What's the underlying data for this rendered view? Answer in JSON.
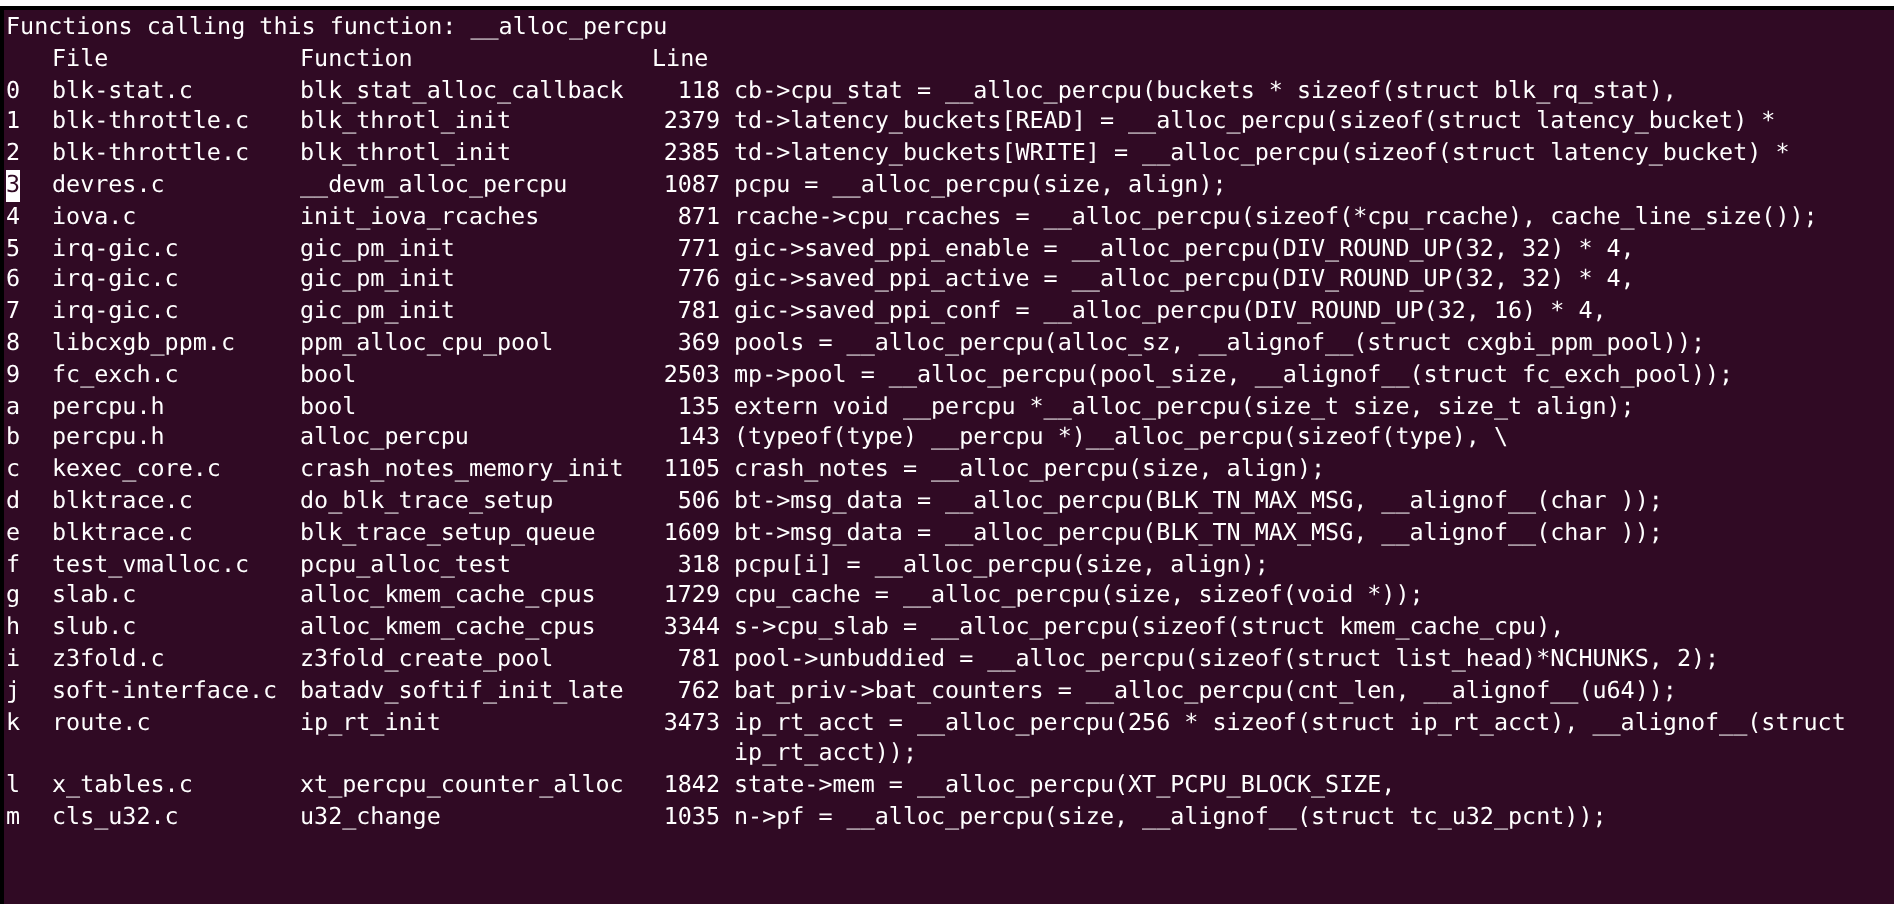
{
  "title": "Functions calling this function: __alloc_percpu",
  "columns": [
    "File",
    "Function",
    "Line"
  ],
  "rows": [
    {
      "index": "0",
      "file": "blk-stat.c",
      "function": "blk_stat_alloc_callback",
      "line": "118",
      "code": "cb->cpu_stat = __alloc_percpu(buckets * sizeof(struct blk_rq_stat),",
      "selected": false
    },
    {
      "index": "1",
      "file": "blk-throttle.c",
      "function": "blk_throtl_init",
      "line": "2379",
      "code": "td->latency_buckets[READ] = __alloc_percpu(sizeof(struct latency_bucket) *",
      "selected": false
    },
    {
      "index": "2",
      "file": "blk-throttle.c",
      "function": "blk_throtl_init",
      "line": "2385",
      "code": "td->latency_buckets[WRITE] = __alloc_percpu(sizeof(struct latency_bucket) *",
      "selected": false
    },
    {
      "index": "3",
      "file": "devres.c",
      "function": "__devm_alloc_percpu",
      "line": "1087",
      "code": "pcpu = __alloc_percpu(size, align);",
      "selected": true
    },
    {
      "index": "4",
      "file": "iova.c",
      "function": "init_iova_rcaches",
      "line": "871",
      "code": "rcache->cpu_rcaches = __alloc_percpu(sizeof(*cpu_rcache), cache_line_size());",
      "selected": false
    },
    {
      "index": "5",
      "file": "irq-gic.c",
      "function": "gic_pm_init",
      "line": "771",
      "code": "gic->saved_ppi_enable = __alloc_percpu(DIV_ROUND_UP(32, 32) * 4,",
      "selected": false
    },
    {
      "index": "6",
      "file": "irq-gic.c",
      "function": "gic_pm_init",
      "line": "776",
      "code": "gic->saved_ppi_active = __alloc_percpu(DIV_ROUND_UP(32, 32) * 4,",
      "selected": false
    },
    {
      "index": "7",
      "file": "irq-gic.c",
      "function": "gic_pm_init",
      "line": "781",
      "code": "gic->saved_ppi_conf = __alloc_percpu(DIV_ROUND_UP(32, 16) * 4,",
      "selected": false
    },
    {
      "index": "8",
      "file": "libcxgb_ppm.c",
      "function": "ppm_alloc_cpu_pool",
      "line": "369",
      "code": "pools = __alloc_percpu(alloc_sz, __alignof__(struct cxgbi_ppm_pool));",
      "selected": false
    },
    {
      "index": "9",
      "file": "fc_exch.c",
      "function": "bool",
      "line": "2503",
      "code": "mp->pool = __alloc_percpu(pool_size, __alignof__(struct fc_exch_pool));",
      "selected": false
    },
    {
      "index": "a",
      "file": "percpu.h",
      "function": "bool",
      "line": "135",
      "code": "extern void __percpu *__alloc_percpu(size_t size, size_t align);",
      "selected": false
    },
    {
      "index": "b",
      "file": "percpu.h",
      "function": "alloc_percpu",
      "line": "143",
      "code": "(typeof(type) __percpu *)__alloc_percpu(sizeof(type), \\",
      "selected": false
    },
    {
      "index": "c",
      "file": "kexec_core.c",
      "function": "crash_notes_memory_init",
      "line": "1105",
      "code": "crash_notes = __alloc_percpu(size, align);",
      "selected": false
    },
    {
      "index": "d",
      "file": "blktrace.c",
      "function": "do_blk_trace_setup",
      "line": "506",
      "code": "bt->msg_data = __alloc_percpu(BLK_TN_MAX_MSG, __alignof__(char ));",
      "selected": false
    },
    {
      "index": "e",
      "file": "blktrace.c",
      "function": "blk_trace_setup_queue",
      "line": "1609",
      "code": "bt->msg_data = __alloc_percpu(BLK_TN_MAX_MSG, __alignof__(char ));",
      "selected": false
    },
    {
      "index": "f",
      "file": "test_vmalloc.c",
      "function": "pcpu_alloc_test",
      "line": "318",
      "code": "pcpu[i] = __alloc_percpu(size, align);",
      "selected": false
    },
    {
      "index": "g",
      "file": "slab.c",
      "function": "alloc_kmem_cache_cpus",
      "line": "1729",
      "code": "cpu_cache = __alloc_percpu(size, sizeof(void *));",
      "selected": false
    },
    {
      "index": "h",
      "file": "slub.c",
      "function": "alloc_kmem_cache_cpus",
      "line": "3344",
      "code": "s->cpu_slab = __alloc_percpu(sizeof(struct kmem_cache_cpu),",
      "selected": false
    },
    {
      "index": "i",
      "file": "z3fold.c",
      "function": "z3fold_create_pool",
      "line": "781",
      "code": "pool->unbuddied = __alloc_percpu(sizeof(struct list_head)*NCHUNKS, 2);",
      "selected": false
    },
    {
      "index": "j",
      "file": "soft-interface.c",
      "function": "batadv_softif_init_late",
      "line": "762",
      "code": "bat_priv->bat_counters = __alloc_percpu(cnt_len, __alignof__(u64));",
      "selected": false
    },
    {
      "index": "k",
      "file": "route.c",
      "function": "ip_rt_init",
      "line": "3473",
      "code": "ip_rt_acct = __alloc_percpu(256 * sizeof(struct ip_rt_acct), __alignof__(struct ip_rt_acct));",
      "selected": false
    },
    {
      "index": "l",
      "file": "x_tables.c",
      "function": "xt_percpu_counter_alloc",
      "line": "1842",
      "code": "state->mem = __alloc_percpu(XT_PCPU_BLOCK_SIZE,",
      "selected": false
    },
    {
      "index": "m",
      "file": "cls_u32.c",
      "function": "u32_change",
      "line": "1035",
      "code": "n->pf = __alloc_percpu(size, __alignof__(struct tc_u32_pcnt));",
      "selected": false
    }
  ]
}
